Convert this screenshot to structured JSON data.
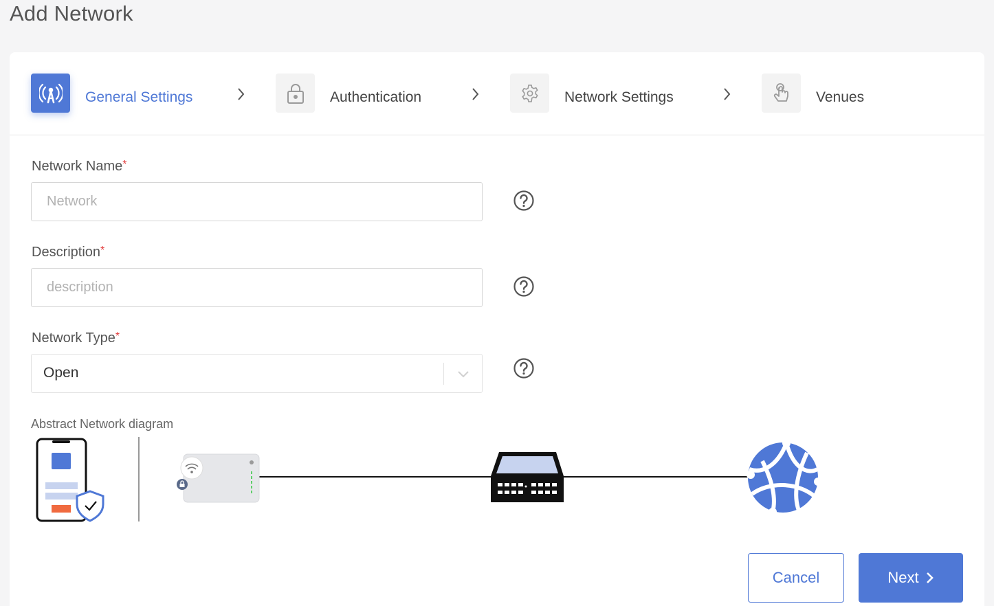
{
  "page": {
    "title": "Add Network"
  },
  "stepper": {
    "steps": [
      {
        "label": "General Settings",
        "icon": "broadcast-antenna-icon",
        "active": true
      },
      {
        "label": "Authentication",
        "icon": "lock-icon",
        "active": false
      },
      {
        "label": "Network Settings",
        "icon": "gear-icon",
        "active": false
      },
      {
        "label": "Venues",
        "icon": "hand-pointer-icon",
        "active": false
      }
    ]
  },
  "form": {
    "network_name": {
      "label": "Network Name",
      "required_mark": "*",
      "placeholder": "Network",
      "value": ""
    },
    "description": {
      "label": "Description",
      "required_mark": "*",
      "placeholder": "description",
      "value": ""
    },
    "network_type": {
      "label": "Network Type",
      "required_mark": "*",
      "value": "Open"
    }
  },
  "diagram": {
    "label": "Abstract Network diagram",
    "nodes": [
      "phone-shield-icon",
      "access-point-icon",
      "switch-icon",
      "globe-icon"
    ]
  },
  "actions": {
    "cancel_label": "Cancel",
    "next_label": "Next"
  },
  "colors": {
    "accent": "#4f78d6",
    "required": "#e23b3b",
    "warning": "#f06a3f"
  }
}
